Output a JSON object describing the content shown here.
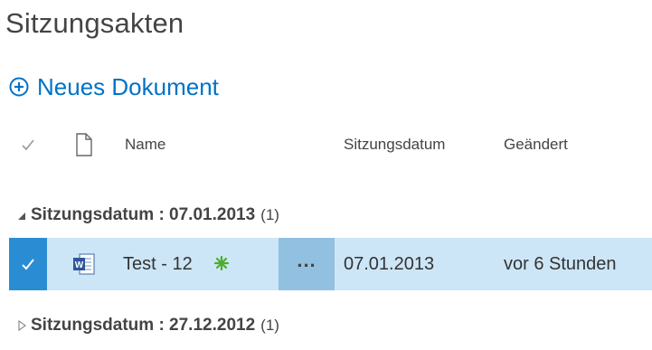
{
  "page_title": "Sitzungsakten",
  "new_document": {
    "label": "Neues Dokument"
  },
  "columns": {
    "name": "Name",
    "sitzungsdatum": "Sitzungsdatum",
    "geaendert": "Geändert"
  },
  "groups": [
    {
      "label": "Sitzungsdatum : 07.01.2013",
      "count": "(1)",
      "expanded": true,
      "rows": [
        {
          "name": "Test - 12",
          "icon": "word-document-icon",
          "is_new": true,
          "sitzungsdatum": "07.01.2013",
          "geaendert": "vor 6 Stunden",
          "selected": true
        }
      ]
    },
    {
      "label": "Sitzungsdatum : 27.12.2012",
      "count": "(1)",
      "expanded": false
    }
  ],
  "colors": {
    "accent": "#0072c6",
    "selected_row": "#cde6f7",
    "checkbox_selected": "#2a8dd4",
    "ellipsis_bg": "#92c0e0",
    "new_marker": "#4cae2b"
  }
}
